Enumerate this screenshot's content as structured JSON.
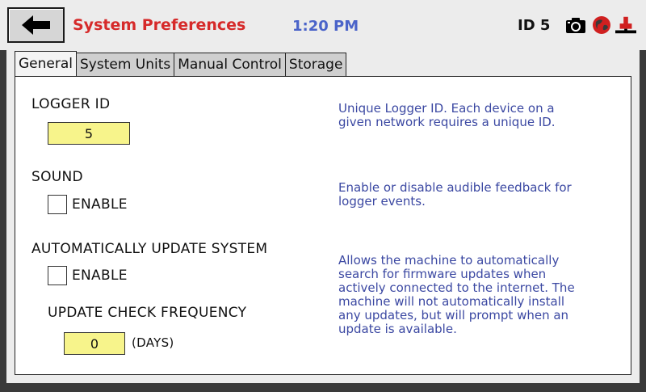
{
  "header": {
    "title": "System Preferences",
    "time": "1:20 PM",
    "device_id": "ID 5",
    "back_icon": "arrow-left-icon",
    "camera_icon": "camera-icon",
    "globe_icon": "globe-icon",
    "plug_icon": "plug-icon",
    "colors": {
      "title": "#d62a2a",
      "time": "#4a63c9",
      "field": "#f7f48b",
      "desc": "#3b48a2"
    }
  },
  "tabs": [
    {
      "label": "General",
      "active": true
    },
    {
      "label": "System Units",
      "active": false
    },
    {
      "label": "Manual Control",
      "active": false
    },
    {
      "label": "Storage",
      "active": false
    }
  ],
  "general": {
    "logger_id": {
      "label": "LOGGER ID",
      "value": "5",
      "description": "Unique Logger ID.  Each device on a\ngiven network requires a unique ID."
    },
    "sound": {
      "label": "SOUND",
      "checkbox_label": "ENABLE",
      "checked": false,
      "description": "Enable or disable audible feedback for\nlogger events."
    },
    "auto_update": {
      "label": "AUTOMATICALLY UPDATE SYSTEM",
      "checkbox_label": "ENABLE",
      "checked": false,
      "frequency_label": "UPDATE CHECK FREQUENCY",
      "frequency_value": "0",
      "frequency_unit": "(DAYS)",
      "description": "Allows the machine to automatically\nsearch for firmware updates when\nactively connected to the internet.  The\nmachine will not automatically install\nany updates, but will prompt when an\nupdate is available."
    }
  }
}
